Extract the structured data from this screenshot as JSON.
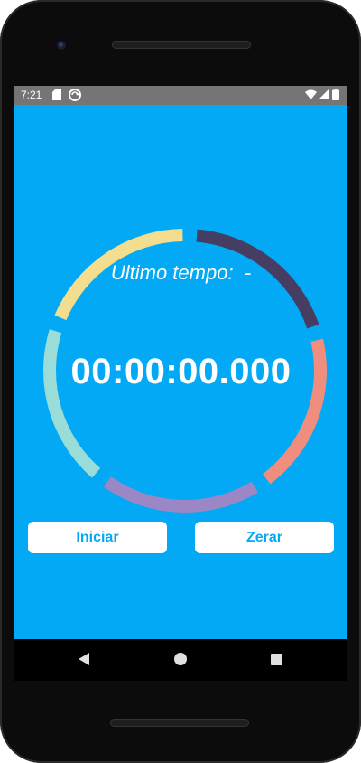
{
  "status_bar": {
    "time": "7:21",
    "icons": [
      "sd-card-icon",
      "sync-icon",
      "wifi-icon",
      "signal-icon",
      "battery-icon"
    ]
  },
  "header": {
    "label": "Ultimo tempo:",
    "value": "-"
  },
  "timer": {
    "display": "00:00:00.000"
  },
  "ring": {
    "segment_colors": [
      "#f3dd8f",
      "#463e62",
      "#ef8e7e",
      "#9b86c6",
      "#9adcd8"
    ]
  },
  "buttons": {
    "start_label": "Iniciar",
    "reset_label": "Zerar"
  },
  "colors": {
    "background": "#03a9f4",
    "button_bg": "#ffffff",
    "button_text": "#03a9f4",
    "status_bar": "#757575"
  },
  "navigation": {
    "icons": [
      "back-icon",
      "home-icon",
      "recents-icon"
    ]
  }
}
